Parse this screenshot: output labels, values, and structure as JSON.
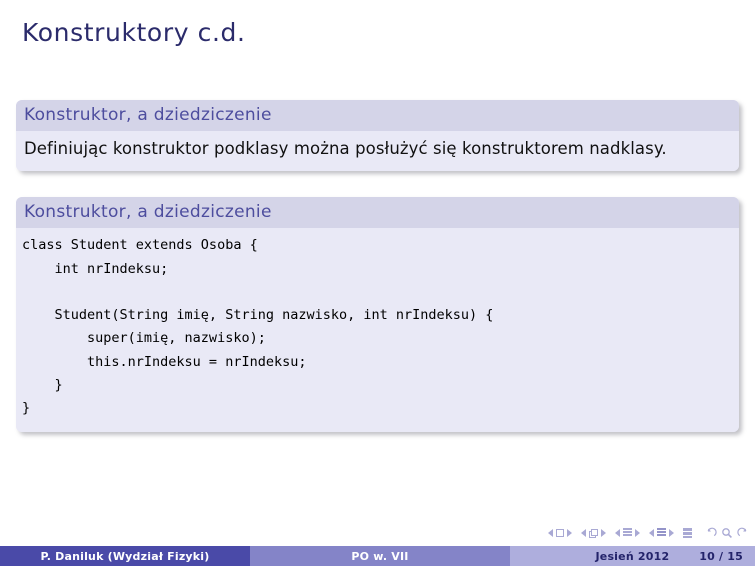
{
  "slide": {
    "title": "Konstruktory c.d."
  },
  "blocks": [
    {
      "title": "Konstruktor, a dziedziczenie",
      "kind": "prose",
      "body": "Definiując konstruktor podklasy można posłużyć się konstruktorem nadklasy."
    },
    {
      "title": "Konstruktor, a dziedziczenie",
      "kind": "code",
      "body": "class Student extends Osoba {\n    int nrIndeksu;\n\n    Student(String imię, String nazwisko, int nrIndeksu) {\n        super(imię, nazwisko);\n        this.nrIndeksu = nrIndeksu;\n    }\n}"
    }
  ],
  "navigation": {
    "icons": [
      "prev-slide-icon",
      "slide-icon",
      "next-slide-icon",
      "prev-frame-icon",
      "frame-icon",
      "next-frame-icon",
      "prev-subsection-icon",
      "subsection-icon",
      "next-subsection-icon",
      "prev-section-icon",
      "section-icon",
      "next-section-icon",
      "presentation-icon",
      "back-icon",
      "search-icon",
      "forward-icon"
    ]
  },
  "footer": {
    "author": "P. Daniluk  (Wydział Fizyki)",
    "course": "PO w. VII",
    "term": "Jesień 2012",
    "page": "10 / 15"
  },
  "colors": {
    "title": "#2b2b6b",
    "block_title": "#4d4d9e",
    "block_title_bg": "#d4d4e8",
    "block_body_bg": "#e9e9f6",
    "footer_dark": "#4a4aa8",
    "footer_mid": "#8484c8",
    "footer_light": "#aeaedd",
    "nav": "#a9a9d4"
  }
}
